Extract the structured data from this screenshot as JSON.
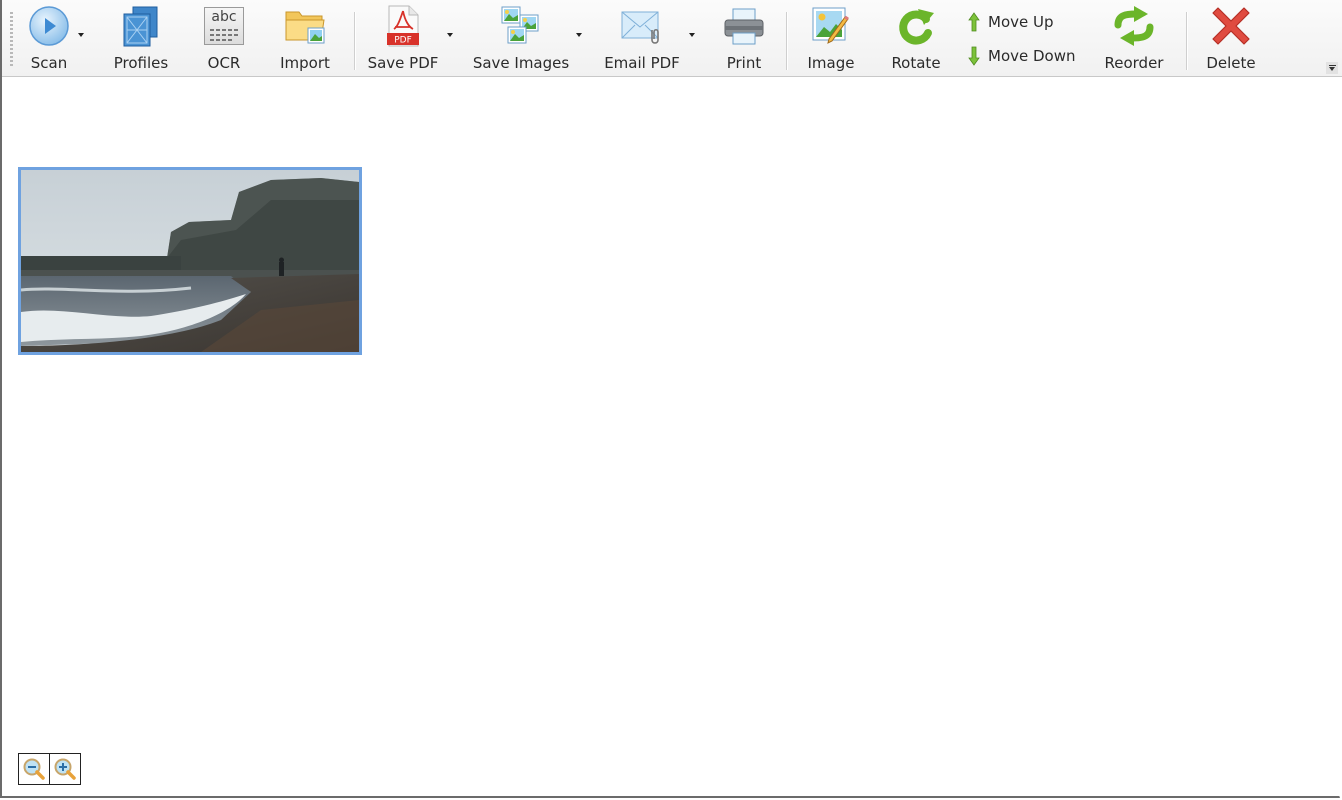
{
  "toolbar": {
    "buttons": [
      {
        "id": "scan",
        "label": "Scan",
        "icon": "play-circle-icon",
        "has_dropdown": true
      },
      {
        "id": "profiles",
        "label": "Profiles",
        "icon": "profiles-blueprint-icon",
        "has_dropdown": false
      },
      {
        "id": "ocr",
        "label": "OCR",
        "icon": "ocr-abc-icon",
        "icon_text": "abc",
        "has_dropdown": false
      },
      {
        "id": "import",
        "label": "Import",
        "icon": "folder-image-icon",
        "has_dropdown": false
      },
      {
        "id": "save_pdf",
        "label": "Save PDF",
        "icon": "pdf-file-icon",
        "icon_text": "PDF",
        "has_dropdown": true
      },
      {
        "id": "save_images",
        "label": "Save Images",
        "icon": "images-stack-icon",
        "has_dropdown": true
      },
      {
        "id": "email_pdf",
        "label": "Email PDF",
        "icon": "envelope-attachment-icon",
        "has_dropdown": true
      },
      {
        "id": "print",
        "label": "Print",
        "icon": "printer-icon",
        "has_dropdown": false
      },
      {
        "id": "image",
        "label": "Image",
        "icon": "image-edit-icon",
        "has_dropdown": false
      },
      {
        "id": "rotate",
        "label": "Rotate",
        "icon": "rotate-arrow-icon",
        "has_dropdown": false
      },
      {
        "id": "move_up",
        "label": "Move Up",
        "icon": "arrow-up-icon"
      },
      {
        "id": "move_down",
        "label": "Move Down",
        "icon": "arrow-down-icon"
      },
      {
        "id": "reorder",
        "label": "Reorder",
        "icon": "reorder-arrows-icon",
        "has_dropdown": false
      },
      {
        "id": "delete",
        "label": "Delete",
        "icon": "red-x-icon",
        "has_dropdown": false
      }
    ],
    "overflow_icon": "toolbar-overflow-icon"
  },
  "pages": [
    {
      "index": 1,
      "selected": true,
      "description": "Beach with cliffs and waves, person walking on pebbles"
    }
  ],
  "zoom_controls": {
    "zoom_out_icon": "zoom-out-icon",
    "zoom_in_icon": "zoom-in-icon"
  },
  "colors": {
    "selection_border": "#6fa2e0",
    "accent_green": "#6bb52a",
    "delete_red": "#e04b40",
    "pdf_red": "#d8322a"
  }
}
